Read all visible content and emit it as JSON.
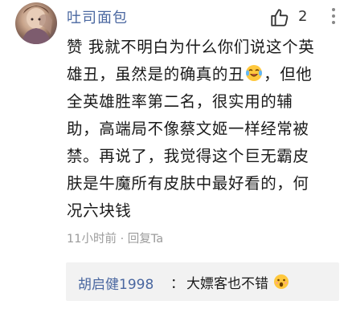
{
  "comment": {
    "username": "吐司面包",
    "like_count": "2",
    "line1": "赞 我就不明白为什么你们说这个英",
    "line2a": "雄丑，虽然是的确真的丑",
    "line2b": "，但他",
    "line3": "全英雄胜率第二名，很实用的辅",
    "line4": "助，高端局不像蔡文姬一样经常被",
    "line5": "禁。再说了，我觉得这个巨无霸皮",
    "line6": "肤是牛魔所有皮肤中最好看的，何",
    "line7": "况六块钱",
    "time": "11小时前",
    "dot": "·",
    "reply_action": "回复Ta",
    "emoji": "laugh-cry-emoji"
  },
  "reply": {
    "user": "胡启健1998",
    "separator": "：",
    "text": "大嫖客也不错",
    "emoji": "shocked-emoji"
  },
  "colors": {
    "username": "#4a67a0",
    "meta": "#9b9b9b",
    "reply_bg": "#f2f2f2"
  }
}
